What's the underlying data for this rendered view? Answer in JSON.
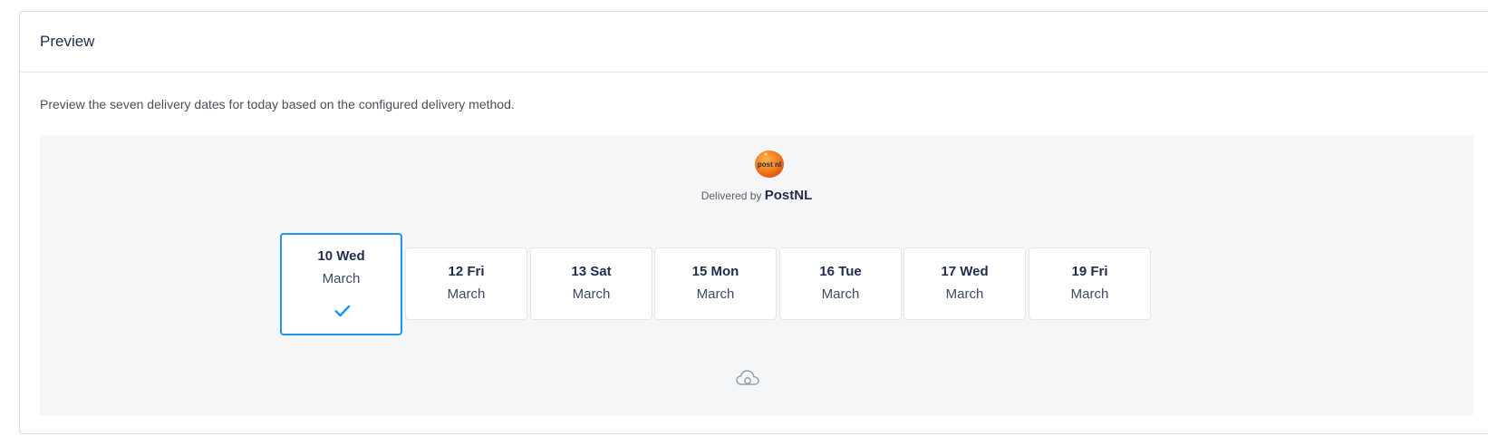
{
  "panel": {
    "title": "Preview",
    "description": "Preview the seven delivery dates for today based on the configured delivery method."
  },
  "carrier": {
    "delivered_prefix": "Delivered by",
    "name": "PostNL",
    "logo_text": "post nl",
    "logo_icon": "postnl-logo",
    "brand_color": "#f47c20"
  },
  "dates": [
    {
      "day": "10 Wed",
      "month": "March",
      "selected": true
    },
    {
      "day": "12 Fri",
      "month": "March",
      "selected": false
    },
    {
      "day": "13 Sat",
      "month": "March",
      "selected": false
    },
    {
      "day": "15 Mon",
      "month": "March",
      "selected": false
    },
    {
      "day": "16 Tue",
      "month": "March",
      "selected": false
    },
    {
      "day": "17 Wed",
      "month": "March",
      "selected": false
    },
    {
      "day": "19 Fri",
      "month": "March",
      "selected": false
    }
  ],
  "icons": {
    "selected": "check-icon",
    "footer": "cloud-icon"
  },
  "colors": {
    "accent": "#2196f3",
    "title": "#1f2d4b",
    "preview_bg": "#f5f6f8"
  }
}
